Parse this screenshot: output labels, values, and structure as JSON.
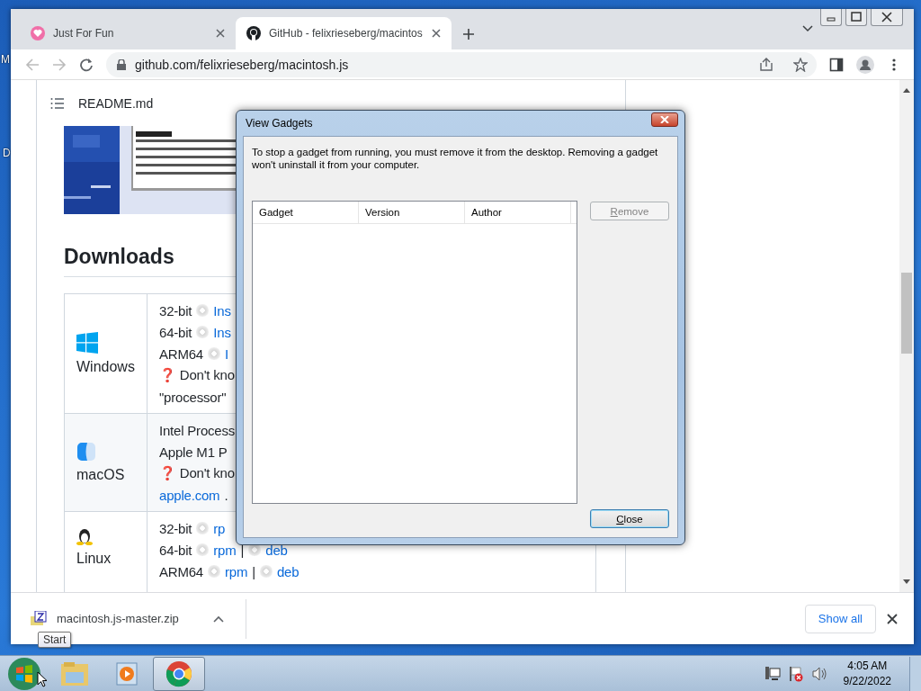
{
  "desktop": {
    "icon_labels": [
      "M",
      "D"
    ]
  },
  "browser": {
    "tabs": [
      {
        "title": "Just For Fun",
        "kind": "heart",
        "selected": false
      },
      {
        "title": "GitHub - felixrieseberg/macintos",
        "kind": "github",
        "selected": true
      }
    ],
    "url": "github.com/felixrieseberg/macintosh.js",
    "readme_title": "README.md",
    "downloads_heading": "Downloads",
    "platforms": [
      {
        "name": "Windows",
        "kind": "windows",
        "lines": [
          [
            {
              "kind": "text",
              "text": "32-bit"
            },
            {
              "kind": "disc"
            },
            {
              "kind": "link",
              "text": "Ins"
            }
          ],
          [
            {
              "kind": "text",
              "text": "64-bit"
            },
            {
              "kind": "disc"
            },
            {
              "kind": "link",
              "text": "Ins"
            }
          ],
          [
            {
              "kind": "text",
              "text": "ARM64"
            },
            {
              "kind": "disc"
            },
            {
              "kind": "link",
              "text": "I"
            }
          ],
          [
            {
              "kind": "text",
              "text": "❓ Don't kno"
            }
          ],
          [
            {
              "kind": "text",
              "text": "\"processor\""
            }
          ]
        ]
      },
      {
        "name": "macOS",
        "kind": "macos",
        "lines": [
          [
            {
              "kind": "text",
              "text": "Intel Process"
            }
          ],
          [
            {
              "kind": "text",
              "text": "Apple M1 P"
            }
          ],
          [
            {
              "kind": "text",
              "text": "❓ Don't kno"
            }
          ],
          [
            {
              "kind": "link",
              "text": "apple.com"
            },
            {
              "kind": "text",
              "text": "."
            }
          ]
        ]
      },
      {
        "name": "Linux",
        "kind": "linux",
        "lines": [
          [
            {
              "kind": "text",
              "text": "32-bit"
            },
            {
              "kind": "disc"
            },
            {
              "kind": "link",
              "text": "rp"
            }
          ],
          [
            {
              "kind": "text",
              "text": "64-bit"
            },
            {
              "kind": "disc"
            },
            {
              "kind": "link",
              "text": "rpm"
            },
            {
              "kind": "text",
              "text": "|"
            },
            {
              "kind": "disc"
            },
            {
              "kind": "link",
              "text": "deb"
            }
          ],
          [
            {
              "kind": "text",
              "text": "ARM64"
            },
            {
              "kind": "disc"
            },
            {
              "kind": "link",
              "text": "rpm"
            },
            {
              "kind": "text",
              "text": "|"
            },
            {
              "kind": "disc"
            },
            {
              "kind": "link",
              "text": "deb"
            }
          ]
        ]
      }
    ],
    "download_bar": {
      "file": "macintosh.js-master.zip",
      "show_all": "Show all"
    }
  },
  "dialog": {
    "title": "View Gadgets",
    "message": "To stop a gadget from running, you must remove it from the desktop. Removing a gadget won't uninstall it from your computer.",
    "columns": [
      "Gadget",
      "Version",
      "Author"
    ],
    "remove_button": {
      "label": "Remove",
      "disabled": true
    },
    "close_button": {
      "label": "Close",
      "default": true
    }
  },
  "tooltip": "Start",
  "taskbar": {
    "apps": [
      {
        "kind": "folder",
        "active": false
      },
      {
        "kind": "media",
        "active": false
      },
      {
        "kind": "chrome",
        "active": true
      }
    ],
    "time": "4:05 AM",
    "date": "9/22/2022"
  }
}
